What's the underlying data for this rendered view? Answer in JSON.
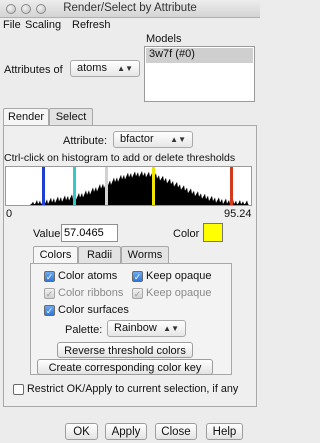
{
  "window": {
    "title": "Render/Select by Attribute"
  },
  "menu": [
    "File",
    "Scaling",
    "Refresh"
  ],
  "attributes_of": {
    "label": "Attributes of",
    "value": "atoms"
  },
  "models": {
    "label": "Models",
    "items": [
      "3w7f (#0)"
    ]
  },
  "tabs": [
    "Render",
    "Select"
  ],
  "attribute": {
    "label": "Attribute:",
    "value": "bfactor"
  },
  "histogram": {
    "instruction": "Ctrl-click on histogram to add or delete thresholds",
    "min_label": "0",
    "max_label": "95.24",
    "thresholds": [
      {
        "value": 14.5,
        "color": "#1f3fd0"
      },
      {
        "value": 26.5,
        "color": "#34c8c8"
      },
      {
        "value": 38.9,
        "color": "#d2d2d2"
      },
      {
        "value": 57.0465,
        "color": "#f0e400"
      },
      {
        "value": 87.5,
        "color": "#d13b1c"
      }
    ]
  },
  "value": {
    "label": "Value",
    "value": "57.0465"
  },
  "color": {
    "label": "Color",
    "swatch": "#ffff00"
  },
  "subtabs": [
    "Colors",
    "Radii",
    "Worms"
  ],
  "checks": {
    "color_atoms": {
      "label": "Color atoms",
      "checked": true,
      "enabled": true
    },
    "keep_opaque_1": {
      "label": "Keep opaque",
      "checked": true,
      "enabled": true
    },
    "color_ribbons": {
      "label": "Color ribbons",
      "checked": true,
      "enabled": false
    },
    "keep_opaque_2": {
      "label": "Keep opaque",
      "checked": true,
      "enabled": false
    },
    "color_surfaces": {
      "label": "Color surfaces",
      "checked": true,
      "enabled": true
    }
  },
  "palette": {
    "label": "Palette:",
    "value": "Rainbow"
  },
  "buttons": {
    "reverse": "Reverse threshold colors",
    "color_key": "Create corresponding color key",
    "ok": "OK",
    "apply": "Apply",
    "close": "Close",
    "help": "Help"
  },
  "restrict": {
    "label": "Restrict OK/Apply to current selection, if any",
    "checked": false
  }
}
